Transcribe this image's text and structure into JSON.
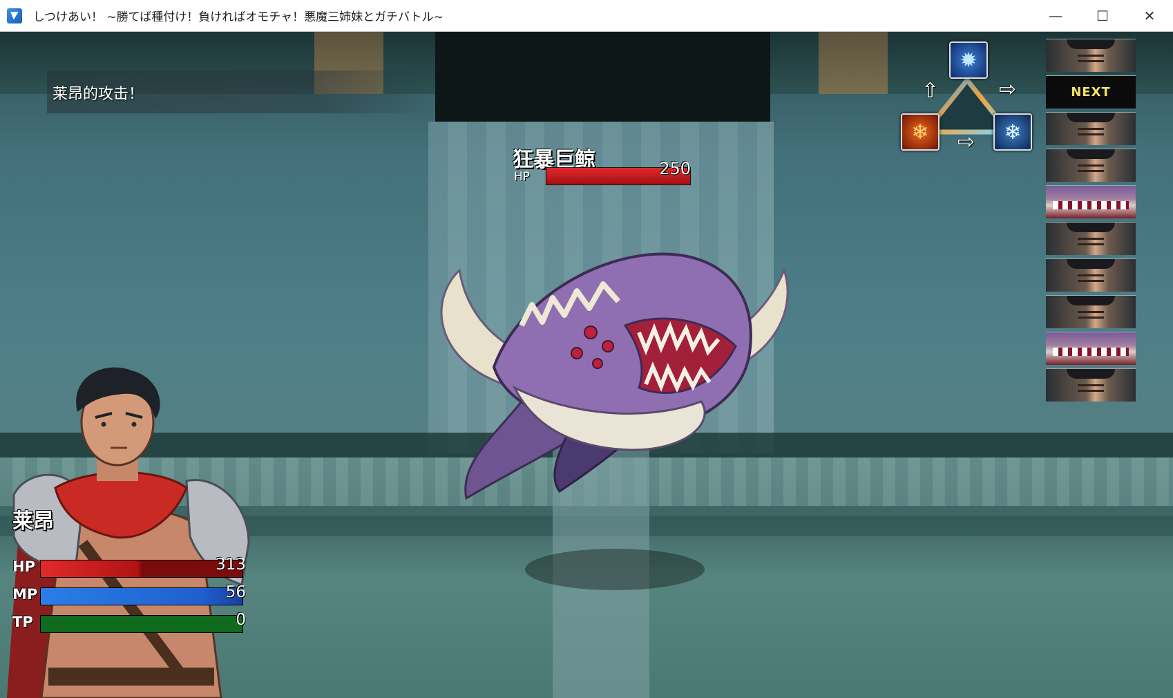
{
  "window": {
    "title": "しつけあい！ ~勝てば種付け！負ければオモチャ！悪魔三姉妹とガチバトル~",
    "minimize_icon": "minimize-icon",
    "maximize_icon": "maximize-icon",
    "close_icon": "close-icon"
  },
  "battle": {
    "message": "莱昂的攻击！",
    "enemy": {
      "name": "狂暴巨鲸",
      "hp_label": "HP",
      "hp": "250"
    },
    "actor": {
      "name": "莱昂",
      "hp_label": "HP",
      "hp": "313",
      "mp_label": "MP",
      "mp": "56",
      "tp_label": "TP",
      "tp": "0"
    },
    "elements": {
      "top": "water-icon",
      "left": "fire-icon",
      "right": "ice-icon"
    },
    "turn_order": {
      "next_label": "NEXT",
      "slots": [
        "hero",
        "next",
        "hero",
        "hero",
        "enemy",
        "hero",
        "hero",
        "hero",
        "enemy",
        "hero"
      ]
    }
  }
}
